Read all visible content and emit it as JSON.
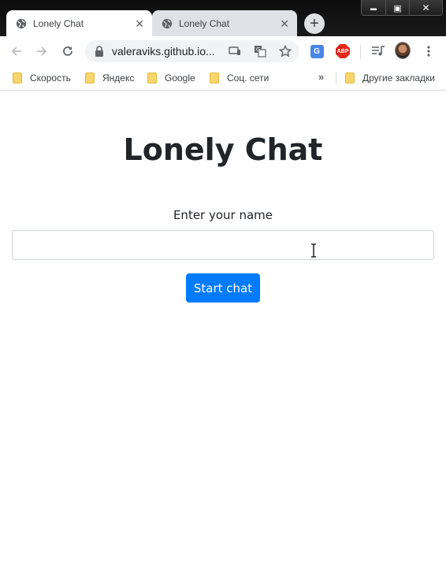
{
  "browser": {
    "window_controls": {
      "minimize": "▬",
      "maximize": "▣",
      "close": "✕"
    },
    "tabs": [
      {
        "title": "Lonely Chat",
        "active": true,
        "icon": "globe-icon"
      },
      {
        "title": "Lonely Chat",
        "active": false,
        "icon": "globe-icon"
      }
    ],
    "tab_close_glyph": "✕",
    "new_tab_glyph": "+",
    "address_bar": {
      "url": "valeraviks.github.io..."
    },
    "bookmarks": [
      {
        "label": "Скорость"
      },
      {
        "label": "Яндекс"
      },
      {
        "label": "Google"
      },
      {
        "label": "Соц. сети"
      }
    ],
    "bookmarks_overflow": "»",
    "other_bookmarks": "Другие закладки",
    "extensions": {
      "adblock": "ABP",
      "translate": "G"
    }
  },
  "page": {
    "title": "Lonely Chat",
    "name_label": "Enter your name",
    "name_input_value": "",
    "name_input_placeholder": "",
    "start_button": "Start chat"
  },
  "colors": {
    "primary_button": "#007bff",
    "title_text": "#212529",
    "titlebar": "#111111",
    "inactive_tab": "#dee1e6"
  }
}
